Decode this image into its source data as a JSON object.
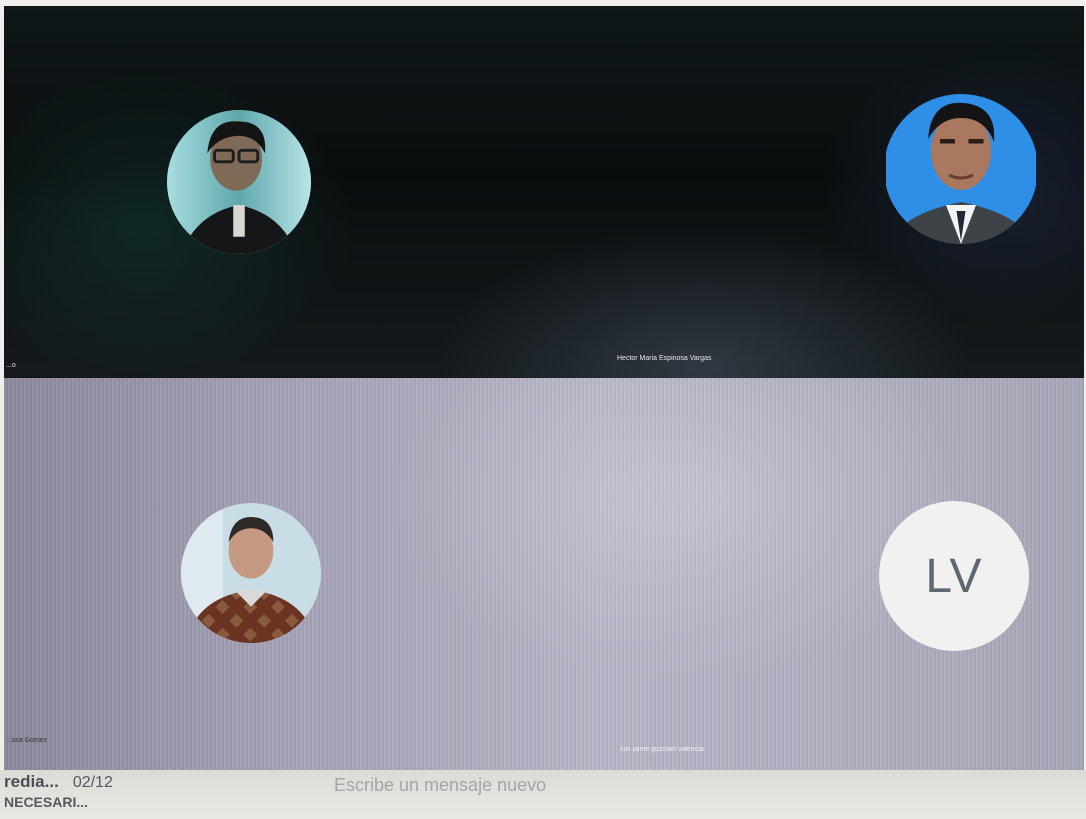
{
  "participants": [
    {
      "name": "...o",
      "type": "photo"
    },
    {
      "name": "Hector Maria Espinosa Vargas",
      "type": "photo"
    },
    {
      "name": "...ssa Gomez",
      "type": "photo"
    },
    {
      "name": "luis jaime guzman valencia",
      "type": "initials",
      "initials": "LV"
    }
  ],
  "chat": {
    "conversation_title": "redia...",
    "conversation_date": "02/12",
    "conversation_preview": "NECESARI...",
    "input_placeholder": "Escribe un mensaje nuevo"
  },
  "colors": {
    "top_band": "#0c1112",
    "bottom_band": "#a9a8bb",
    "initials_bg": "#f1f1f0",
    "initials_text": "#5d6873"
  }
}
